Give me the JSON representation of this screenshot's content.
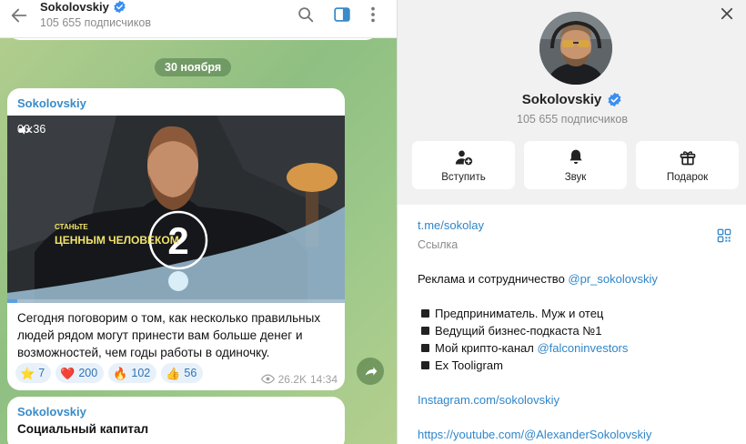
{
  "chat": {
    "header": {
      "title": "Sokolovskiy",
      "subscribers": "105 655 подписчиков"
    },
    "date_pill": "30 ноября",
    "post": {
      "author": "Sokolovskiy",
      "video": {
        "duration": "00:36",
        "overlay_line1": "СТАНЬТЕ",
        "overlay_line2": "ЦЕННЫМ ЧЕЛОВЕКОМ",
        "overlay_number": "2",
        "progress": 0.03
      },
      "text": "Сегодня поговорим о том, как несколько правильных людей рядом могут принести вам больше денег и возможностей, чем годы работы в одиночку.",
      "reactions": [
        {
          "emoji": "⭐",
          "count": "7"
        },
        {
          "emoji": "❤️",
          "count": "200"
        },
        {
          "emoji": "🔥",
          "count": "102"
        },
        {
          "emoji": "👍",
          "count": "56"
        }
      ],
      "views": "26.2K",
      "time": "14:34"
    },
    "next_post": {
      "author": "Sokolovskiy",
      "headline": "Социальный капитал"
    }
  },
  "info": {
    "title": "Sokolovskiy",
    "subscribers": "105 655 подписчиков",
    "actions": [
      {
        "label": "Вступить",
        "icon": "join-icon"
      },
      {
        "label": "Звук",
        "icon": "bell-icon"
      },
      {
        "label": "Подарок",
        "icon": "gift-icon"
      }
    ],
    "link": "t.me/sokolay",
    "link_caption": "Ссылка",
    "ads_text": "Реклама и сотрудничество ",
    "ads_handle": "@pr_sokolovskiy",
    "bullets": [
      {
        "text": "Предприниматель. Муж и отец",
        "link": ""
      },
      {
        "text": "Ведущий бизнес-подкаста №1",
        "link": ""
      },
      {
        "text": "Мой крипто-канал ",
        "link": "@falconinvestors"
      },
      {
        "text": "Ex Tooligram",
        "link": ""
      }
    ],
    "instagram": "Instagram.com/sokolovskiy",
    "youtube": "https://youtube.com/@AlexanderSokolovskiy"
  },
  "colors": {
    "accent": "#3a8bc8",
    "link": "#2f86c9",
    "verified": "#3a8ef0",
    "chat_bg": "#9cc88a"
  }
}
